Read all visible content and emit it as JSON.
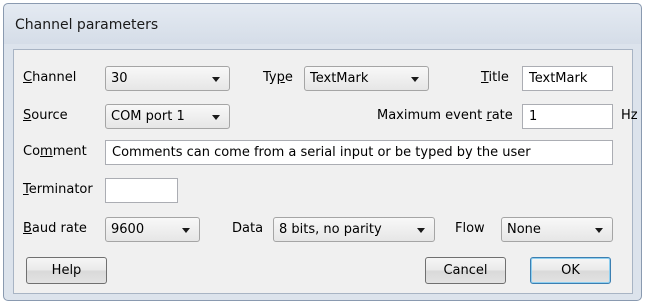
{
  "window": {
    "title": "Channel parameters"
  },
  "labels": {
    "channel_prefix": "",
    "channel_accel": "C",
    "channel_rest": "hannel",
    "type_prefix": "Ty",
    "type_accel": "p",
    "type_rest": "e",
    "title_prefix": "",
    "title_accel": "T",
    "title_rest": "itle",
    "source_prefix": "",
    "source_accel": "S",
    "source_rest": "ource",
    "rate_prefix": "Maximum event ",
    "rate_accel": "r",
    "rate_rest": "ate",
    "rate_unit": "Hz",
    "comment_prefix": "Co",
    "comment_accel": "m",
    "comment_rest": "ment",
    "terminator_prefix": "",
    "terminator_accel": "T",
    "terminator_rest": "erminator",
    "baud_prefix": "",
    "baud_accel": "B",
    "baud_rest": "aud rate",
    "data": "Data",
    "flow": "Flow"
  },
  "fields": {
    "channel": "30",
    "type": "TextMark",
    "title": "TextMark",
    "source": "COM port 1",
    "max_event_rate": "1",
    "comment": "Comments can come from a serial input or be typed by the user",
    "terminator": "",
    "baud_rate": "9600",
    "data": "8 bits, no parity",
    "flow": "None"
  },
  "buttons": {
    "help": "Help",
    "cancel": "Cancel",
    "ok": "OK"
  },
  "icons": {
    "dropdown": "chevron-down-icon"
  }
}
